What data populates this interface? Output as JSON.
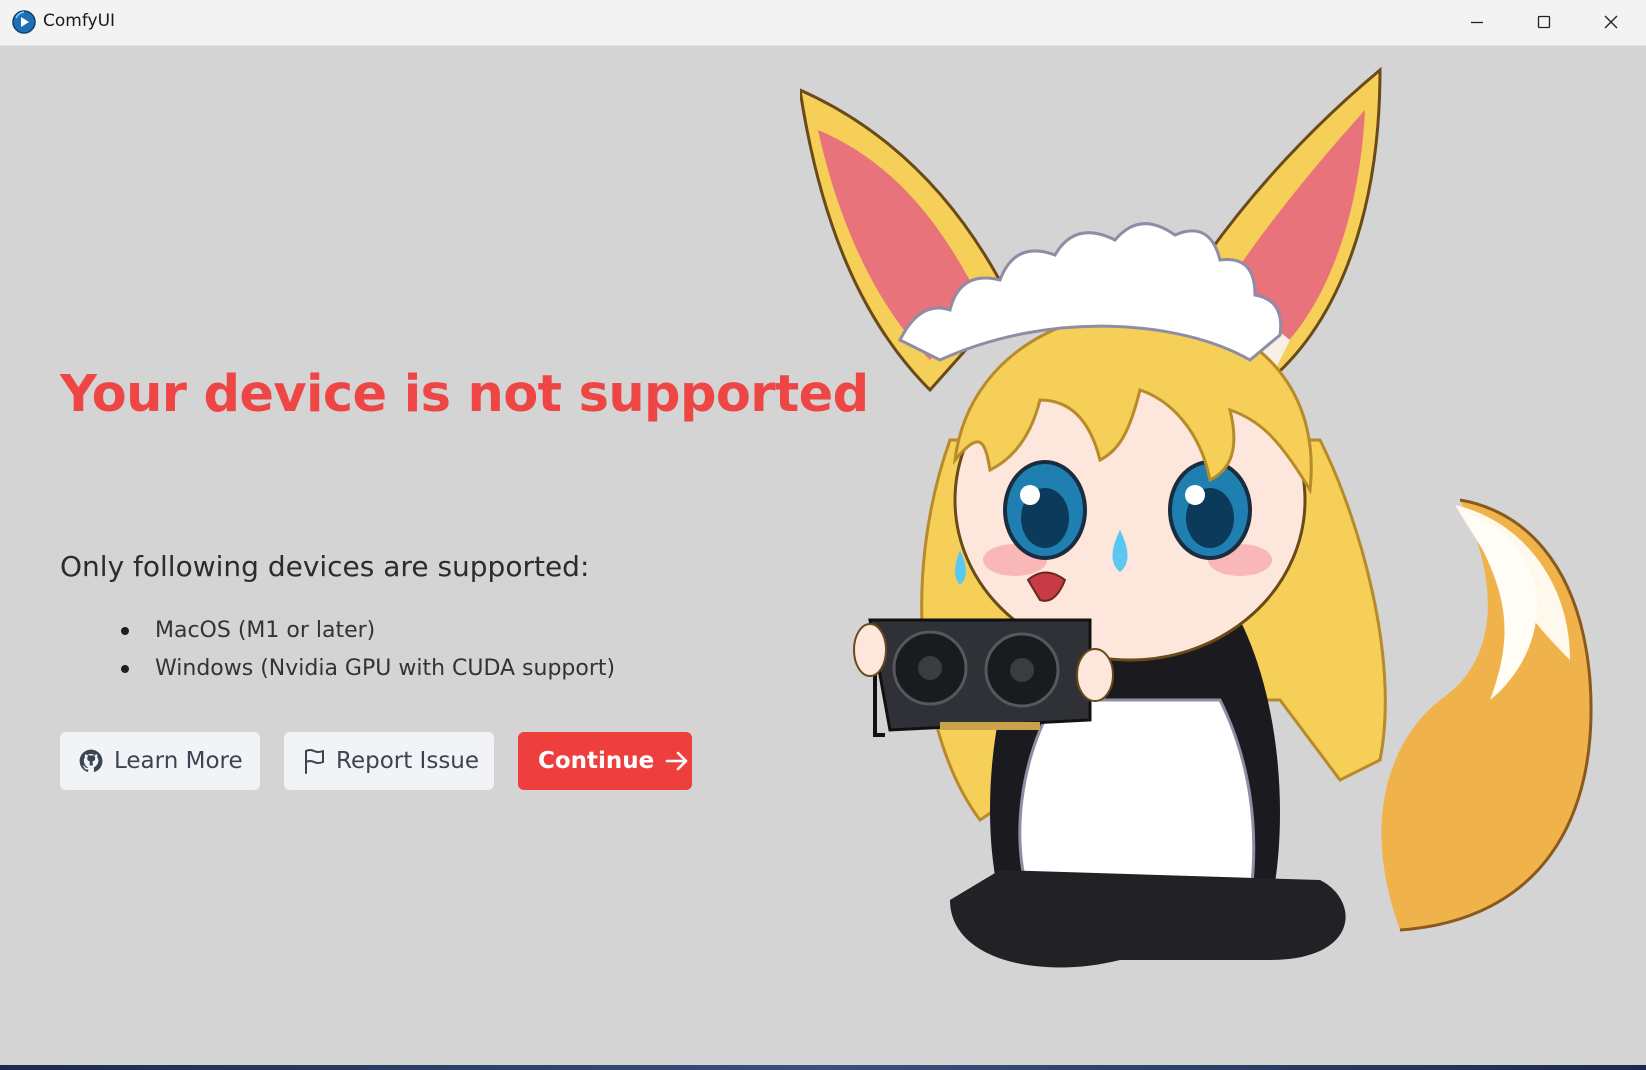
{
  "window": {
    "title": "ComfyUI",
    "icon": "comfyui-logo-icon",
    "controls": {
      "minimize": "minimize-icon",
      "maximize": "maximize-icon",
      "close": "close-icon"
    }
  },
  "main": {
    "headline": "Your device is not supported",
    "subtitle": "Only following devices are supported:",
    "devices": [
      "MacOS (M1 or later)",
      "Windows (Nvidia GPU with CUDA support)"
    ],
    "buttons": {
      "learn_more": "Learn More",
      "report_issue": "Report Issue",
      "continue": "Continue"
    },
    "illustration": "crying-fox-maid-holding-gpu-illustration"
  },
  "colors": {
    "background": "#d4d4d4",
    "headline": "#ee4545",
    "accent_button": "#ee3e3e",
    "secondary_button": "#f1f3f6"
  }
}
